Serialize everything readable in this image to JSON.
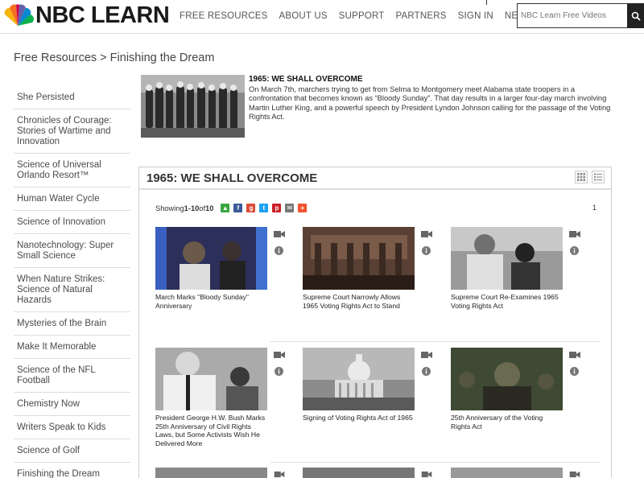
{
  "header": {
    "logo_text": "NBC LEARN",
    "nav": [
      "FREE RESOURCES",
      "ABOUT US",
      "SUPPORT",
      "PARTNERS",
      "SIGN IN",
      "NEW USER"
    ],
    "search_placeholder": "NBC Learn Free Videos"
  },
  "breadcrumb": "Free Resources > Finishing the Dream",
  "sidebar": {
    "items": [
      "She Persisted",
      "Chronicles of Courage: Stories of Wartime and Innovation",
      "Science of Universal Orlando Resort™",
      "Human Water Cycle",
      "Science of Innovation",
      "Nanotechnology: Super Small Science",
      "When Nature Strikes: Science of Natural Hazards",
      "Mysteries of the Brain",
      "Make It Memorable",
      "Science of the NFL Football",
      "Chemistry Now",
      "Writers Speak to Kids",
      "Science of Golf",
      "Finishing the Dream"
    ]
  },
  "intro": {
    "title": "1965: WE SHALL OVERCOME",
    "body": "On March 7th, marchers trying to get from Selma to Montgomery meet Alabama state troopers in a confrontation that becomes known as “Bloody Sunday”. That day results in a larger four-day march involving Martin Luther King, and a powerful speech by President Lyndon Johnson calling for the passage of the Voting Rights Act."
  },
  "panel": {
    "title": "1965: WE SHALL OVERCOME",
    "showing_prefix": "Showing ",
    "showing_range": "1-10",
    "showing_of": " of ",
    "showing_total": "10",
    "page": "1"
  },
  "videos": [
    {
      "title": "March Marks \"Bloody Sunday\" Anniversary"
    },
    {
      "title": "Supreme Court Narrowly Allows 1965 Voting Rights Act to Stand"
    },
    {
      "title": "Supreme Court Re-Examines 1965 Voting Rights Act"
    },
    {
      "title": "President George H.W. Bush Marks 25th Anniversary of Civil Rights Laws, but Some Activists Wish He Delivered More"
    },
    {
      "title": "Signing of Voting Rights Act of 1965"
    },
    {
      "title": "25th Anniversary of the Voting Rights Act"
    }
  ],
  "colors": {
    "share_green": "#3aa640",
    "share_facebook": "#3b5998",
    "share_google": "#dd4b39",
    "share_twitter": "#1da1f2",
    "share_pinterest": "#cb2027",
    "share_email": "#777777",
    "share_more": "#f0532f"
  }
}
